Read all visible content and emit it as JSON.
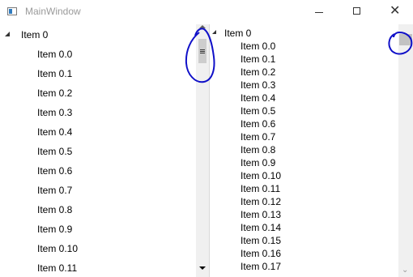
{
  "window": {
    "title": "MainWindow"
  },
  "left_tree": {
    "root": "Item 0",
    "children": [
      "Item 0.0",
      "Item 0.1",
      "Item 0.2",
      "Item 0.3",
      "Item 0.4",
      "Item 0.5",
      "Item 0.6",
      "Item 0.7",
      "Item 0.8",
      "Item 0.9",
      "Item 0.10",
      "Item 0.11"
    ]
  },
  "right_tree": {
    "root": "Item 0",
    "children": [
      "Item 0.0",
      "Item 0.1",
      "Item 0.2",
      "Item 0.3",
      "Item 0.4",
      "Item 0.5",
      "Item 0.6",
      "Item 0.7",
      "Item 0.8",
      "Item 0.9",
      "Item 0.10",
      "Item 0.11",
      "Item 0.12",
      "Item 0.13",
      "Item 0.14",
      "Item 0.15",
      "Item 0.16",
      "Item 0.17"
    ]
  },
  "icons": {
    "app": "window-icon",
    "minimize": "minimize-icon",
    "maximize": "maximize-icon",
    "close": "close-icon",
    "expander": "expanded-triangle-icon",
    "scroll_up": "scroll-up-arrow-icon",
    "scroll_down": "scroll-down-arrow-icon"
  },
  "colors": {
    "annotation": "#1010c8",
    "title_text": "#9a9a9a",
    "scroll_track": "#f0f0f0"
  }
}
